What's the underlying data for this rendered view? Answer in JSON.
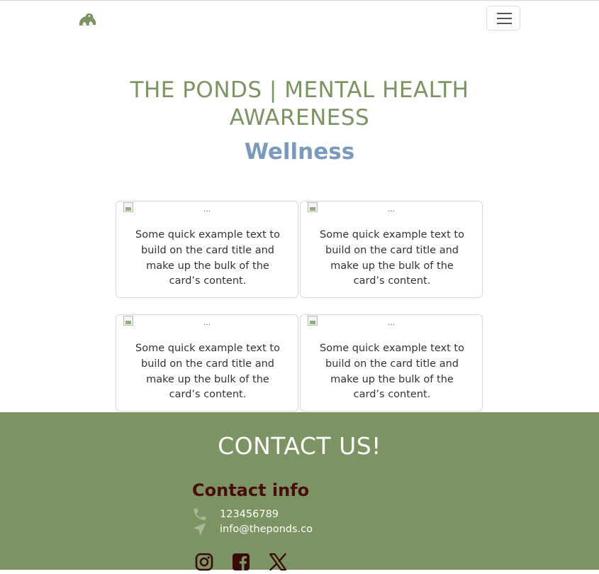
{
  "navbar": {
    "logo_icon": "frog-icon",
    "menu_icon": "hamburger-menu-icon"
  },
  "hero": {
    "title": "THE PONDS | MENTAL HEALTH AWARENESS",
    "subtitle": "Wellness"
  },
  "cards": [
    {
      "image_alt": "...",
      "text": "Some quick example text to build on the card title and make up the bulk of the card’s content."
    },
    {
      "image_alt": "...",
      "text": "Some quick example text to build on the card title and make up the bulk of the card’s content."
    },
    {
      "image_alt": "...",
      "text": "Some quick example text to build on the card title and make up the bulk of the card’s content."
    },
    {
      "image_alt": "...",
      "text": "Some quick example text to build on the card title and make up the bulk of the card’s content."
    }
  ],
  "footer": {
    "title": "CONTACT US!",
    "info_title": "Contact info",
    "phone": "123456789",
    "email": "info@theponds.co",
    "social_icons": [
      "instagram-icon",
      "facebook-icon",
      "x-twitter-icon"
    ]
  },
  "colors": {
    "brand_green": "#7c9463",
    "subtitle_blue": "#7b99bb",
    "footer_heading": "#4a0b0b",
    "social_icon": "#3a0a0a"
  }
}
